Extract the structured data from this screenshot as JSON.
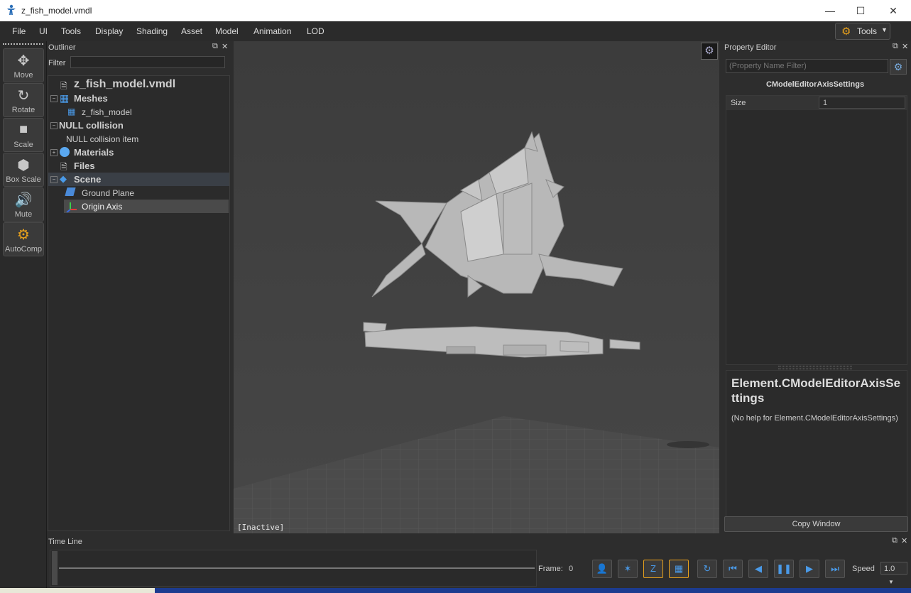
{
  "window": {
    "title": "z_fish_model.vmdl",
    "minimize_icon": "minimize-icon",
    "maximize_icon": "maximize-icon",
    "close_icon": "close-icon"
  },
  "menu": {
    "items": [
      "File",
      "UI",
      "Tools",
      "Display",
      "Shading",
      "Asset",
      "Model",
      "Animation",
      "LOD"
    ],
    "tools_dropdown": "Tools"
  },
  "toolbar": {
    "buttons": [
      {
        "label": "Move",
        "icon": "move-icon"
      },
      {
        "label": "Rotate",
        "icon": "rotate-icon"
      },
      {
        "label": "Scale",
        "icon": "scale-icon"
      },
      {
        "label": "Box Scale",
        "icon": "box-scale-icon"
      },
      {
        "label": "Mute",
        "icon": "speaker-icon"
      },
      {
        "label": "AutoComp",
        "icon": "gears-icon"
      }
    ]
  },
  "outliner": {
    "title": "Outliner",
    "filter_label": "Filter",
    "filter_value": "",
    "tree": {
      "root": "z_fish_model.vmdl",
      "meshes": "Meshes",
      "mesh_item": "z_fish_model",
      "null_collision": "NULL collision",
      "null_collision_item": "NULL collision item",
      "materials": "Materials",
      "files": "Files",
      "scene": "Scene",
      "ground_plane": "Ground Plane",
      "origin_axis": "Origin Axis"
    }
  },
  "viewport": {
    "status": "[Inactive]"
  },
  "property_editor": {
    "title": "Property Editor",
    "filter_placeholder": "(Property Name Filter)",
    "class_name": "CModelEditorAxisSettings",
    "rows": [
      {
        "label": "Size",
        "value": "1"
      }
    ],
    "help_title": "Element.CModelEditorAxisSettings",
    "help_text": "(No help for Element.CModelEditorAxisSettings)",
    "copy_button": "Copy Window"
  },
  "timeline": {
    "title": "Time Line",
    "frame_label": "Frame:",
    "frame_value": "0",
    "speed_label": "Speed",
    "speed_value": "1.0"
  },
  "colors": {
    "accent_orange": "#e8a11c",
    "selection": "#4a4a4a",
    "playback_blue": "#4a9ae8"
  }
}
